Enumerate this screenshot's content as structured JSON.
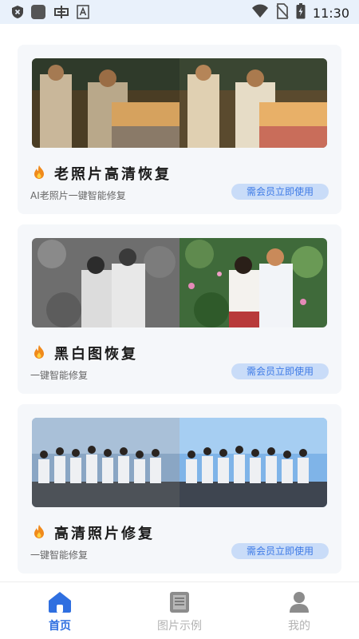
{
  "status_bar": {
    "time": "11:30",
    "icons": [
      "shield-icon",
      "square-icon",
      "app-icon",
      "text-a-icon",
      "wifi-icon",
      "no-sim-icon",
      "battery-charging-icon"
    ]
  },
  "cards": [
    {
      "title": "老照片高清恢复",
      "subtitle": "AI老照片一键智能修复",
      "button": "需会员立即使用",
      "icon": "fire-icon"
    },
    {
      "title": "黑白图恢复",
      "subtitle": "一键智能修复",
      "button": "需会员立即使用",
      "icon": "fire-icon"
    },
    {
      "title": "高清照片修复",
      "subtitle": "一键智能修复",
      "button": "需会员立即使用",
      "icon": "fire-icon"
    }
  ],
  "bottom_nav": {
    "items": [
      {
        "label": "首页",
        "icon": "home-icon",
        "active": true
      },
      {
        "label": "图片示例",
        "icon": "document-icon",
        "active": false
      },
      {
        "label": "我的",
        "icon": "user-icon",
        "active": false
      }
    ]
  },
  "colors": {
    "accent": "#2f6fe0",
    "button_bg": "#c9dcf8",
    "button_text": "#3f7be6",
    "status_bar_bg": "#e9f1fb",
    "card_bg": "#f5f7fa"
  }
}
